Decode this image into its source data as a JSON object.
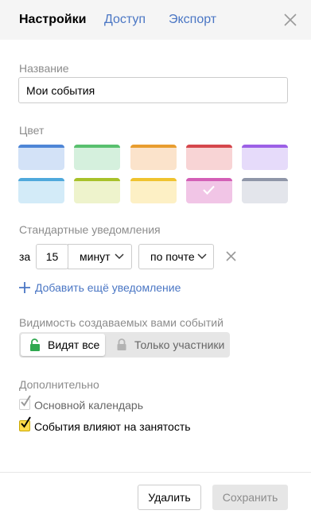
{
  "tabs": {
    "settings": "Настройки",
    "access": "Доступ",
    "export": "Экспорт"
  },
  "name_section": {
    "label": "Название",
    "value": "Мои события"
  },
  "color_section": {
    "label": "Цвет",
    "swatches": [
      {
        "name": "blue",
        "stripe": "#4e86d6",
        "fill": "#d3e2f7",
        "selected": false
      },
      {
        "name": "green",
        "stripe": "#59c06e",
        "fill": "#d5f0dd",
        "selected": false
      },
      {
        "name": "orange",
        "stripe": "#e89d2f",
        "fill": "#fbe3cb",
        "selected": false
      },
      {
        "name": "red",
        "stripe": "#d5474c",
        "fill": "#f8d4d5",
        "selected": false
      },
      {
        "name": "purple",
        "stripe": "#9c60e6",
        "fill": "#e6dbfa",
        "selected": false
      },
      {
        "name": "light-blue",
        "stripe": "#4fa9dc",
        "fill": "#d3ebf8",
        "selected": false
      },
      {
        "name": "olive",
        "stripe": "#a8c12a",
        "fill": "#eef3cc",
        "selected": false
      },
      {
        "name": "yellow",
        "stripe": "#efc32f",
        "fill": "#fdf0c5",
        "selected": false
      },
      {
        "name": "pink",
        "stripe": "#d35fb6",
        "fill": "#f1c5e6",
        "selected": true
      },
      {
        "name": "gray",
        "stripe": "#8f96a8",
        "fill": "#e3e5eb",
        "selected": false
      }
    ]
  },
  "notifications": {
    "label": "Стандартные уведомления",
    "prefix": "за",
    "amount": "15",
    "unit": "минут",
    "channel": "по почте",
    "add_label": "Добавить ещё уведомление"
  },
  "visibility": {
    "label": "Видимость создаваемых вами событий",
    "option_all": "Видят все",
    "option_participants": "Только участники",
    "selected": "all"
  },
  "extra": {
    "label": "Дополнительно",
    "primary_calendar": {
      "label": "Основной календарь",
      "checked": true,
      "disabled": true
    },
    "busy": {
      "label": "События влияют на занятость",
      "checked": true,
      "disabled": false
    }
  },
  "footer": {
    "delete": "Удалить",
    "save": "Сохранить"
  },
  "colors": {
    "link": "#4a76c4",
    "lock_open": "#2fa84f"
  }
}
